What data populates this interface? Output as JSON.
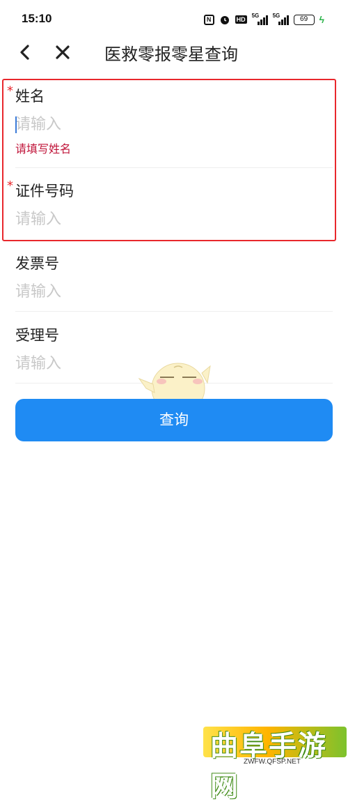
{
  "status_bar": {
    "time": "15:10",
    "hd_label": "HD",
    "signal1_label": "5G",
    "signal2_label": "5G",
    "battery": "69"
  },
  "nav": {
    "title": "医救零报零星查询",
    "back_icon": "chevron-left-icon",
    "close_icon": "close-icon"
  },
  "form": {
    "name": {
      "label": "姓名",
      "required_mark": "*",
      "placeholder": "请输入",
      "error": "请填写姓名"
    },
    "id_number": {
      "label": "证件号码",
      "required_mark": "*",
      "placeholder": "请输入"
    },
    "invoice": {
      "label": "发票号",
      "placeholder": "请输入"
    },
    "acceptance": {
      "label": "受理号",
      "placeholder": "请输入"
    }
  },
  "query_button": "查询",
  "colors": {
    "accent": "#1f8bf3",
    "error": "#c0153a",
    "required": "#e8272c",
    "highlight_border": "#e8272c"
  },
  "watermark": {
    "text": "曲阜手游网",
    "url": "ZWFW.QFSP.NET"
  }
}
